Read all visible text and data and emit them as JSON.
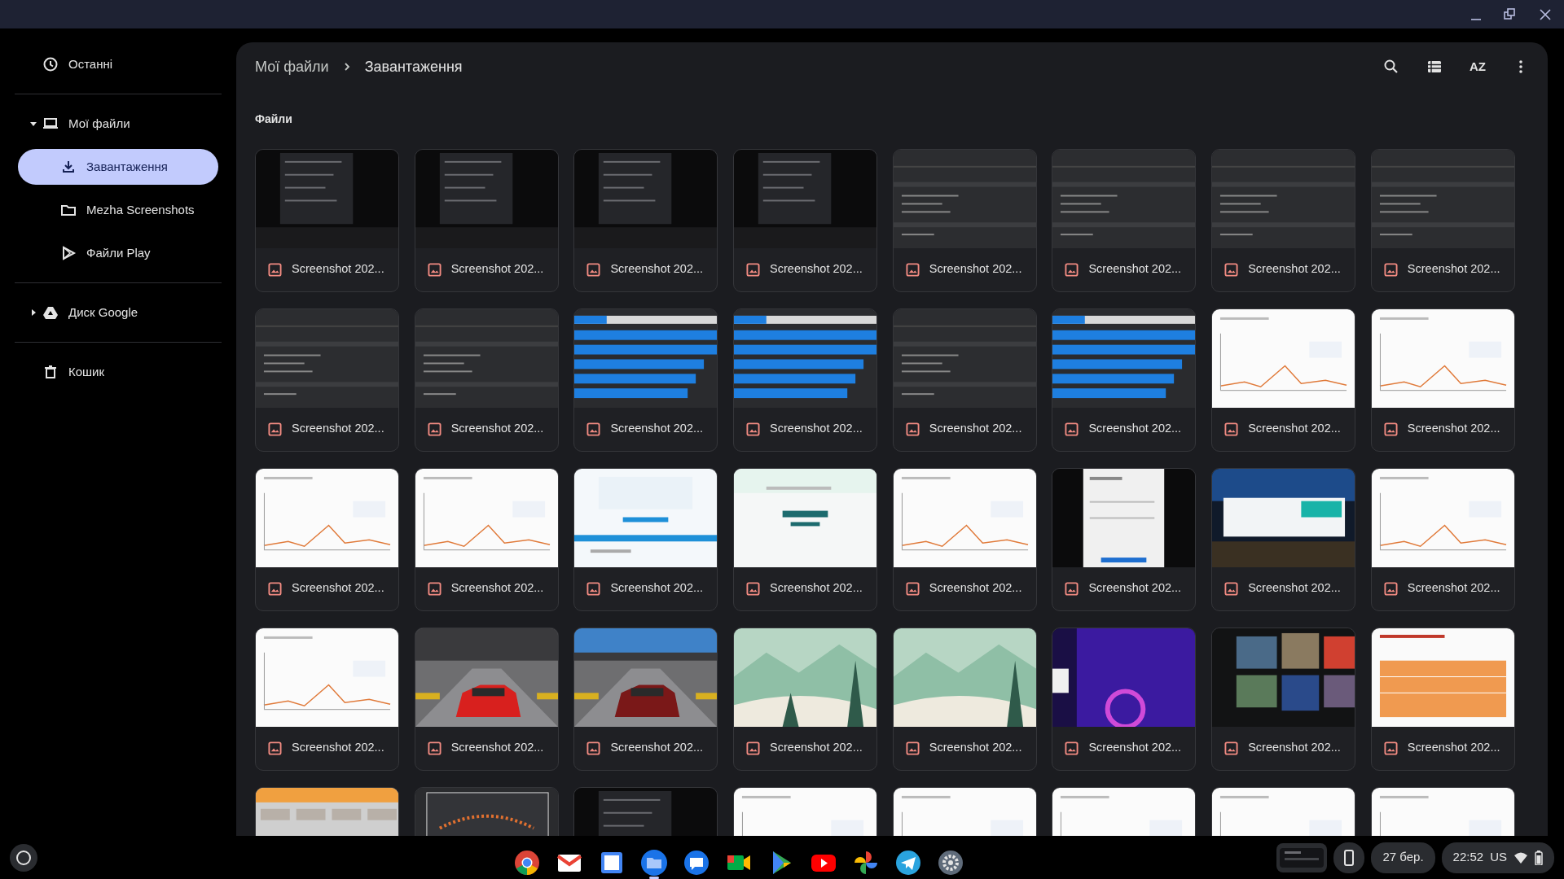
{
  "window": {
    "controls": [
      {
        "kind": "minimize"
      },
      {
        "kind": "maximize"
      },
      {
        "kind": "close"
      }
    ]
  },
  "sidebar": [
    {
      "kind": "recent",
      "label": "Останні",
      "selected": false
    },
    {
      "kind": "computer",
      "label": "Мої файли",
      "selected": false,
      "expanded": true,
      "children": [
        {
          "kind": "download",
          "label": "Завантаження",
          "selected": true
        },
        {
          "kind": "folder",
          "label": "Mezha Screenshots",
          "selected": false
        },
        {
          "kind": "play",
          "label": "Файли Play",
          "selected": false
        }
      ]
    },
    {
      "kind": "drive",
      "label": "Диск Google",
      "selected": false,
      "expanded": false
    },
    {
      "kind": "trash",
      "label": "Кошик",
      "selected": false
    }
  ],
  "breadcrumb": [
    "Мої файли",
    "Завантаження"
  ],
  "toolbar": [
    {
      "kind": "search"
    },
    {
      "kind": "view"
    },
    {
      "kind": "sort",
      "label": "AZ"
    },
    {
      "kind": "menu"
    }
  ],
  "section_title": "Файли",
  "files": [
    {
      "kind": "picture",
      "name": "Screenshot 202..."
    },
    {
      "kind": "picture",
      "name": "Screenshot 202..."
    },
    {
      "kind": "picture",
      "name": "Screenshot 202..."
    },
    {
      "kind": "picture",
      "name": "Screenshot 202..."
    },
    {
      "kind": "picture",
      "name": "Screenshot 202..."
    },
    {
      "kind": "picture",
      "name": "Screenshot 202..."
    },
    {
      "kind": "picture",
      "name": "Screenshot 202..."
    },
    {
      "kind": "picture",
      "name": "Screenshot 202..."
    },
    {
      "kind": "picture",
      "name": "Screenshot 202..."
    },
    {
      "kind": "picture",
      "name": "Screenshot 202..."
    },
    {
      "kind": "picture",
      "name": "Screenshot 202..."
    },
    {
      "kind": "picture",
      "name": "Screenshot 202..."
    },
    {
      "kind": "picture",
      "name": "Screenshot 202..."
    },
    {
      "kind": "picture",
      "name": "Screenshot 202..."
    },
    {
      "kind": "picture",
      "name": "Screenshot 202..."
    },
    {
      "kind": "picture",
      "name": "Screenshot 202..."
    },
    {
      "kind": "picture",
      "name": "Screenshot 202..."
    },
    {
      "kind": "picture",
      "name": "Screenshot 202..."
    },
    {
      "kind": "picture",
      "name": "Screenshot 202..."
    },
    {
      "kind": "picture",
      "name": "Screenshot 202..."
    },
    {
      "kind": "picture",
      "name": "Screenshot 202..."
    },
    {
      "kind": "picture",
      "name": "Screenshot 202..."
    },
    {
      "kind": "picture",
      "name": "Screenshot 202..."
    },
    {
      "kind": "picture",
      "name": "Screenshot 202..."
    },
    {
      "kind": "picture",
      "name": "Screenshot 202..."
    },
    {
      "kind": "picture",
      "name": "Screenshot 202..."
    },
    {
      "kind": "picture",
      "name": "Screenshot 202..."
    },
    {
      "kind": "picture",
      "name": "Screenshot 202..."
    },
    {
      "kind": "picture",
      "name": "Screenshot 202..."
    },
    {
      "kind": "picture",
      "name": "Screenshot 202..."
    },
    {
      "kind": "picture",
      "name": "Screenshot 202..."
    },
    {
      "kind": "picture",
      "name": "Screenshot 202..."
    },
    {
      "kind": "picture"
    },
    {
      "kind": "picture"
    },
    {
      "kind": "picture"
    },
    {
      "kind": "picture"
    },
    {
      "kind": "picture"
    },
    {
      "kind": "picture"
    },
    {
      "kind": "picture"
    },
    {
      "kind": "picture"
    }
  ],
  "shelf": {
    "apps": [
      {
        "kind": "browser",
        "active": false
      },
      {
        "kind": "mail",
        "active": false
      },
      {
        "kind": "calendar",
        "active": false
      },
      {
        "kind": "files",
        "active": true
      },
      {
        "kind": "messages",
        "active": false
      },
      {
        "kind": "meet",
        "active": false
      },
      {
        "kind": "store",
        "active": false
      },
      {
        "kind": "video",
        "active": false
      },
      {
        "kind": "photos",
        "active": false
      },
      {
        "kind": "telegram",
        "active": false
      },
      {
        "kind": "settings",
        "active": false
      }
    ],
    "date": "27 бер.",
    "time": "22:52",
    "keyboard": "US"
  }
}
